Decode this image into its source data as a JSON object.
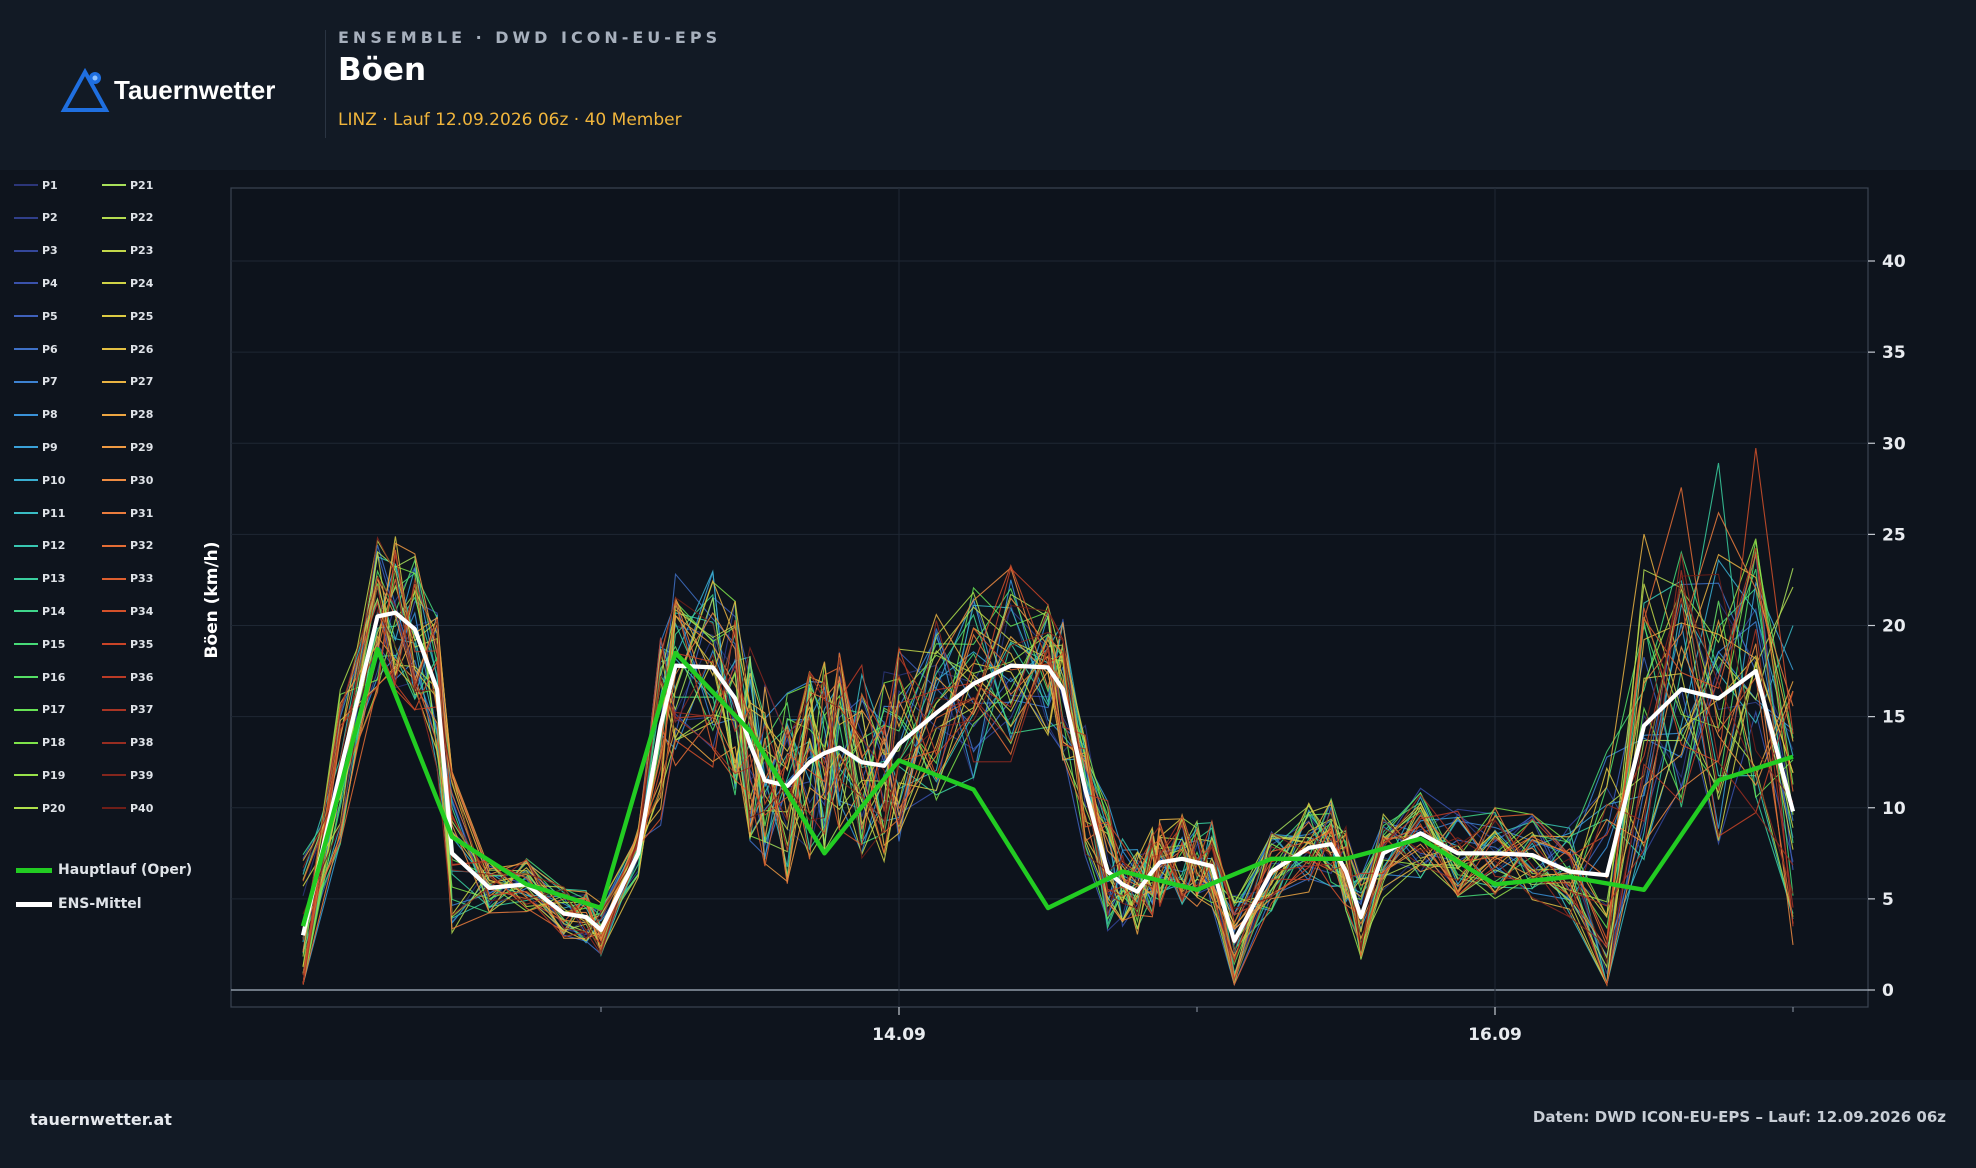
{
  "header": {
    "brand": "Tauernwetter",
    "eyebrow": "ENSEMBLE · DWD ICON-EU-EPS",
    "title": "Böen",
    "subtitle": "LINZ · Lauf 12.09.2026 06z · 40 Member"
  },
  "footer": {
    "site": "tauernwetter.at",
    "source": "Daten: DWD ICON-EU-EPS – Lauf: 12.09.2026 06z"
  },
  "colors": {
    "background": "#0e141d",
    "oper": "#22cc22",
    "mean": "#ffffff",
    "accent": "#f0b53c"
  },
  "legend": {
    "oper_label": "Hauptlauf (Oper)",
    "mean_label": "ENS-Mittel"
  },
  "chart_data": {
    "type": "line",
    "ylabel": "Böen (km/h)",
    "ylim": [
      -1,
      44
    ],
    "yticks": [
      0,
      5,
      10,
      15,
      20,
      25,
      30,
      35,
      40
    ],
    "xlim": [
      -0.5,
      10.5
    ],
    "x_tick_labels": [
      {
        "x": 4,
        "label": "14.09"
      },
      {
        "x": 8,
        "label": "16.09"
      }
    ],
    "minor_ticks": [
      2,
      6,
      10
    ],
    "grid": true,
    "legend_position": "left",
    "members": [
      "P1",
      "P2",
      "P3",
      "P4",
      "P5",
      "P6",
      "P7",
      "P8",
      "P9",
      "P10",
      "P11",
      "P12",
      "P13",
      "P14",
      "P15",
      "P16",
      "P17",
      "P18",
      "P19",
      "P20",
      "P21",
      "P22",
      "P23",
      "P24",
      "P25",
      "P26",
      "P27",
      "P28",
      "P29",
      "P30",
      "P31",
      "P32",
      "P33",
      "P34",
      "P35",
      "P36",
      "P37",
      "P38",
      "P39",
      "P40"
    ],
    "member_colors": [
      "#2c3679",
      "#303f8a",
      "#34479a",
      "#3a52ab",
      "#3f61bb",
      "#3f71c7",
      "#3d82d1",
      "#3a92d8",
      "#3aa1d8",
      "#3aafd1",
      "#39bcc4",
      "#38c7b2",
      "#3acf9f",
      "#3fd68b",
      "#47db78",
      "#55df65",
      "#67e254",
      "#7ee34a",
      "#98e24a",
      "#afe04b",
      "#a8e05a",
      "#b4dc50",
      "#c3d84a",
      "#cfd246",
      "#dccb43",
      "#e3c043",
      "#e9b342",
      "#eda642",
      "#ef9a43",
      "#ee8c42",
      "#ea7c3d",
      "#e46d35",
      "#dd5f2f",
      "#d4512a",
      "#c94427",
      "#bb3b26",
      "#a93524",
      "#972d21",
      "#84261d",
      "#6f1e18"
    ],
    "ensemble_mean": {
      "name": "ENS-Mittel",
      "x": [
        0,
        0.25,
        0.5,
        0.62,
        0.75,
        0.9,
        1.0,
        1.25,
        1.5,
        1.75,
        1.9,
        2.0,
        2.25,
        2.4,
        2.5,
        2.75,
        2.9,
        3.0,
        3.1,
        3.25,
        3.4,
        3.5,
        3.6,
        3.75,
        3.9,
        4.0,
        4.25,
        4.5,
        4.75,
        5.0,
        5.1,
        5.25,
        5.4,
        5.5,
        5.6,
        5.7,
        5.75,
        5.9,
        6.0,
        6.1,
        6.25,
        6.5,
        6.75,
        6.9,
        7.0,
        7.1,
        7.25,
        7.5,
        7.75,
        8.0,
        8.25,
        8.5,
        8.75,
        9.0,
        9.25,
        9.5,
        9.75,
        10.0
      ],
      "y": [
        3,
        12,
        20.5,
        20.7,
        19.8,
        16.5,
        7.5,
        5.6,
        5.8,
        4.2,
        4.0,
        3.3,
        7.5,
        14.5,
        17.8,
        17.7,
        16,
        13.5,
        11.5,
        11.2,
        12.5,
        13.0,
        13.3,
        12.5,
        12.3,
        13.5,
        15.2,
        16.8,
        17.8,
        17.7,
        16.5,
        11,
        6.5,
        5.8,
        5.4,
        6.5,
        7.0,
        7.2,
        7.0,
        6.8,
        2.7,
        6.5,
        7.8,
        8.0,
        6.5,
        4.0,
        7.5,
        8.6,
        7.5,
        7.5,
        7.4,
        6.5,
        6.3,
        14.5,
        16.5,
        16.0,
        17.5,
        9.8
      ]
    },
    "oper_run": {
      "name": "Hauptlauf (Oper)",
      "x": [
        0,
        0.5,
        1,
        1.5,
        2,
        2.5,
        3,
        3.5,
        4,
        4.5,
        5,
        5.5,
        6,
        6.5,
        7,
        7.5,
        8,
        8.5,
        9,
        9.5,
        10
      ],
      "y": [
        3.5,
        18.7,
        8.4,
        5.8,
        4.5,
        18.5,
        14.2,
        7.5,
        12.6,
        11.0,
        4.5,
        6.5,
        5.5,
        7.2,
        7.2,
        8.3,
        5.8,
        6.2,
        5.5,
        11.5,
        12.8
      ]
    },
    "member_pattern": {
      "x": [
        0,
        0.25,
        0.5,
        0.62,
        0.75,
        0.9,
        1.0,
        1.25,
        1.5,
        1.75,
        1.9,
        2.0,
        2.25,
        2.4,
        2.5,
        2.75,
        2.9,
        3.0,
        3.1,
        3.25,
        3.4,
        3.5,
        3.6,
        3.75,
        3.9,
        4.0,
        4.25,
        4.5,
        4.75,
        5.0,
        5.1,
        5.25,
        5.4,
        5.5,
        5.6,
        5.7,
        5.75,
        5.9,
        6.0,
        6.1,
        6.25,
        6.5,
        6.75,
        6.9,
        7.0,
        7.1,
        7.25,
        7.5,
        7.75,
        8.0,
        8.25,
        8.5,
        8.75,
        9.0,
        9.25,
        9.5,
        9.75,
        10.0
      ],
      "y": [
        3,
        12,
        20.5,
        20.7,
        19.8,
        16.5,
        7.5,
        5.6,
        5.8,
        4.2,
        4.0,
        3.3,
        7.5,
        14.5,
        17.8,
        17.7,
        16,
        13.5,
        11.5,
        11.2,
        12.5,
        13.0,
        13.3,
        12.5,
        12.3,
        13.5,
        15.2,
        16.8,
        17.8,
        17.7,
        16.5,
        11,
        6.5,
        5.8,
        5.4,
        6.5,
        7.0,
        7.2,
        7.0,
        6.8,
        2.7,
        6.5,
        7.8,
        8.0,
        6.5,
        4.0,
        7.5,
        8.6,
        7.5,
        7.5,
        7.4,
        6.5,
        6.3,
        14.5,
        16.5,
        16.0,
        17.5,
        9.8
      ]
    }
  }
}
